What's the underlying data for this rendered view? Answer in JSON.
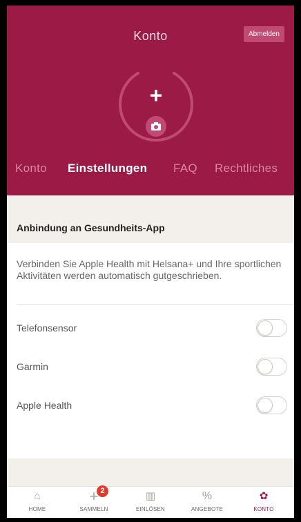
{
  "header": {
    "title": "Konto",
    "logout_label": "Abmelden"
  },
  "tabs": [
    {
      "label": "Konto",
      "active": false
    },
    {
      "label": "Einstellungen",
      "active": true
    },
    {
      "label": "FAQ",
      "active": false
    },
    {
      "label": "Rechtliches",
      "active": false
    }
  ],
  "section": {
    "title": "Anbindung an Gesundheits-App",
    "description": "Verbinden Sie Apple Health mit Helsana+ und Ihre sportlichen Aktivitäten werden automatisch gutgeschrieben."
  },
  "settings": [
    {
      "label": "Telefonsensor",
      "enabled": false
    },
    {
      "label": "Garmin",
      "enabled": false
    },
    {
      "label": "Apple Health",
      "enabled": false
    }
  ],
  "bottom_nav": [
    {
      "label": "HOME",
      "icon": "home-icon",
      "glyph": "⌂"
    },
    {
      "label": "SAMMELN",
      "icon": "plus-icon",
      "glyph": "+",
      "badge": "2"
    },
    {
      "label": "EINLÖSEN",
      "icon": "gift-icon",
      "glyph": "▥"
    },
    {
      "label": "ANGEBOTE",
      "icon": "percent-icon",
      "glyph": "%"
    },
    {
      "label": "KONTO",
      "icon": "gear-icon",
      "glyph": "✿",
      "active": true
    }
  ],
  "colors": {
    "brand": "#9b1a46",
    "badge": "#e03b2c",
    "background": "#f3efeb"
  }
}
